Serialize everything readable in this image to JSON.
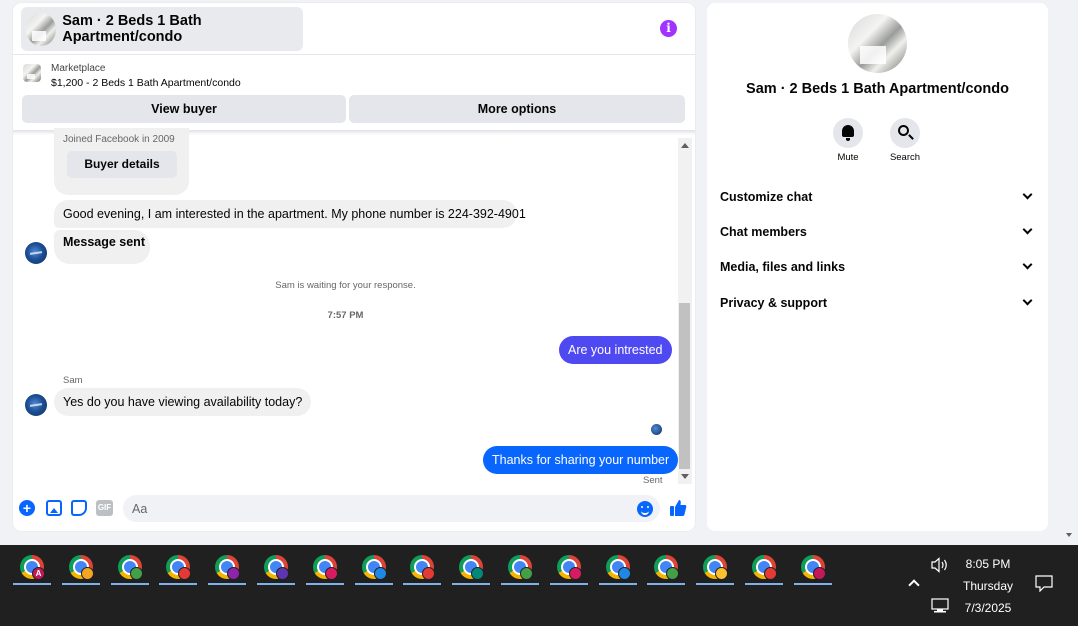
{
  "chat": {
    "header_title": "Sam · 2 Beds 1 Bath Apartment/condo",
    "marketplace_label": "Marketplace",
    "listing": "$1,200 - 2 Beds 1 Bath Apartment/condo",
    "view_buyer": "View buyer",
    "more_options": "More options",
    "joined": "Joined Facebook in 2009",
    "buyer_details": "Buyer details",
    "messages": [
      {
        "from": "buyer",
        "text": "Good evening, I am interested in the apartment. My phone number is 224-392-4901"
      },
      {
        "from": "buyer",
        "text": "Message sent"
      },
      {
        "from": "me",
        "text": "Are you intrested"
      },
      {
        "from": "buyer",
        "text": "Yes do you have viewing availability today?"
      },
      {
        "from": "me",
        "text": "Thanks for sharing your number"
      }
    ],
    "waiting": "Sam is waiting for your response.",
    "time": "7:57 PM",
    "sender_name": "Sam",
    "sent_status": "Sent",
    "input_placeholder": "Aa",
    "gif_label": "GIF"
  },
  "info": {
    "title": "Sam · 2 Beds 1 Bath Apartment/condo",
    "mute_label": "Mute",
    "search_label": "Search",
    "menu": [
      "Customize chat",
      "Chat members",
      "Media, files and links",
      "Privacy & support"
    ]
  },
  "taskbar": {
    "time": "8:05 PM",
    "day": "Thursday",
    "date": "7/3/2025",
    "apps": [
      {
        "badge": "#c2185b",
        "glyph": "A"
      },
      {
        "badge": "#f4a623",
        "glyph": ""
      },
      {
        "badge": "#43a047",
        "glyph": ""
      },
      {
        "badge": "#e53935",
        "glyph": ""
      },
      {
        "badge": "#8e24aa",
        "glyph": ""
      },
      {
        "badge": "#5e35b1",
        "glyph": ""
      },
      {
        "badge": "#d81b60",
        "glyph": ""
      },
      {
        "badge": "#1e88e5",
        "glyph": ""
      },
      {
        "badge": "#e53935",
        "glyph": ""
      },
      {
        "badge": "#00897b",
        "glyph": ""
      },
      {
        "badge": "#43a047",
        "glyph": ""
      },
      {
        "badge": "#d81b60",
        "glyph": ""
      },
      {
        "badge": "#1e88e5",
        "glyph": ""
      },
      {
        "badge": "#43a047",
        "glyph": ""
      },
      {
        "badge": "#fbc02d",
        "glyph": ""
      },
      {
        "badge": "#e53935",
        "glyph": ""
      },
      {
        "badge": "#c2185b",
        "glyph": ""
      }
    ]
  },
  "colors": {
    "accent": "#0866ff",
    "outgoing_purple": "#4f49f2",
    "info_purple": "#a033ff"
  }
}
